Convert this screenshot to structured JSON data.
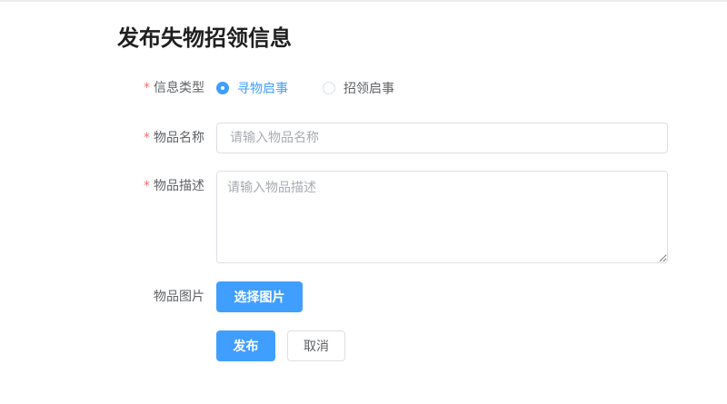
{
  "page": {
    "title": "发布失物招领信息"
  },
  "form": {
    "required_mark": "*",
    "type": {
      "label": "信息类型",
      "options": [
        {
          "label": "寻物启事",
          "checked": true
        },
        {
          "label": "招领启事",
          "checked": false
        }
      ]
    },
    "name": {
      "label": "物品名称",
      "value": "",
      "placeholder": "请输入物品名称"
    },
    "description": {
      "label": "物品描述",
      "value": "",
      "placeholder": "请输入物品描述"
    },
    "image": {
      "label": "物品图片",
      "button_label": "选择图片"
    },
    "actions": {
      "submit_label": "发布",
      "cancel_label": "取消"
    }
  },
  "colors": {
    "primary": "#409eff",
    "required": "#f56c6c",
    "border": "#dcdfe6",
    "placeholder": "#a8abb2",
    "text": "#606266"
  }
}
